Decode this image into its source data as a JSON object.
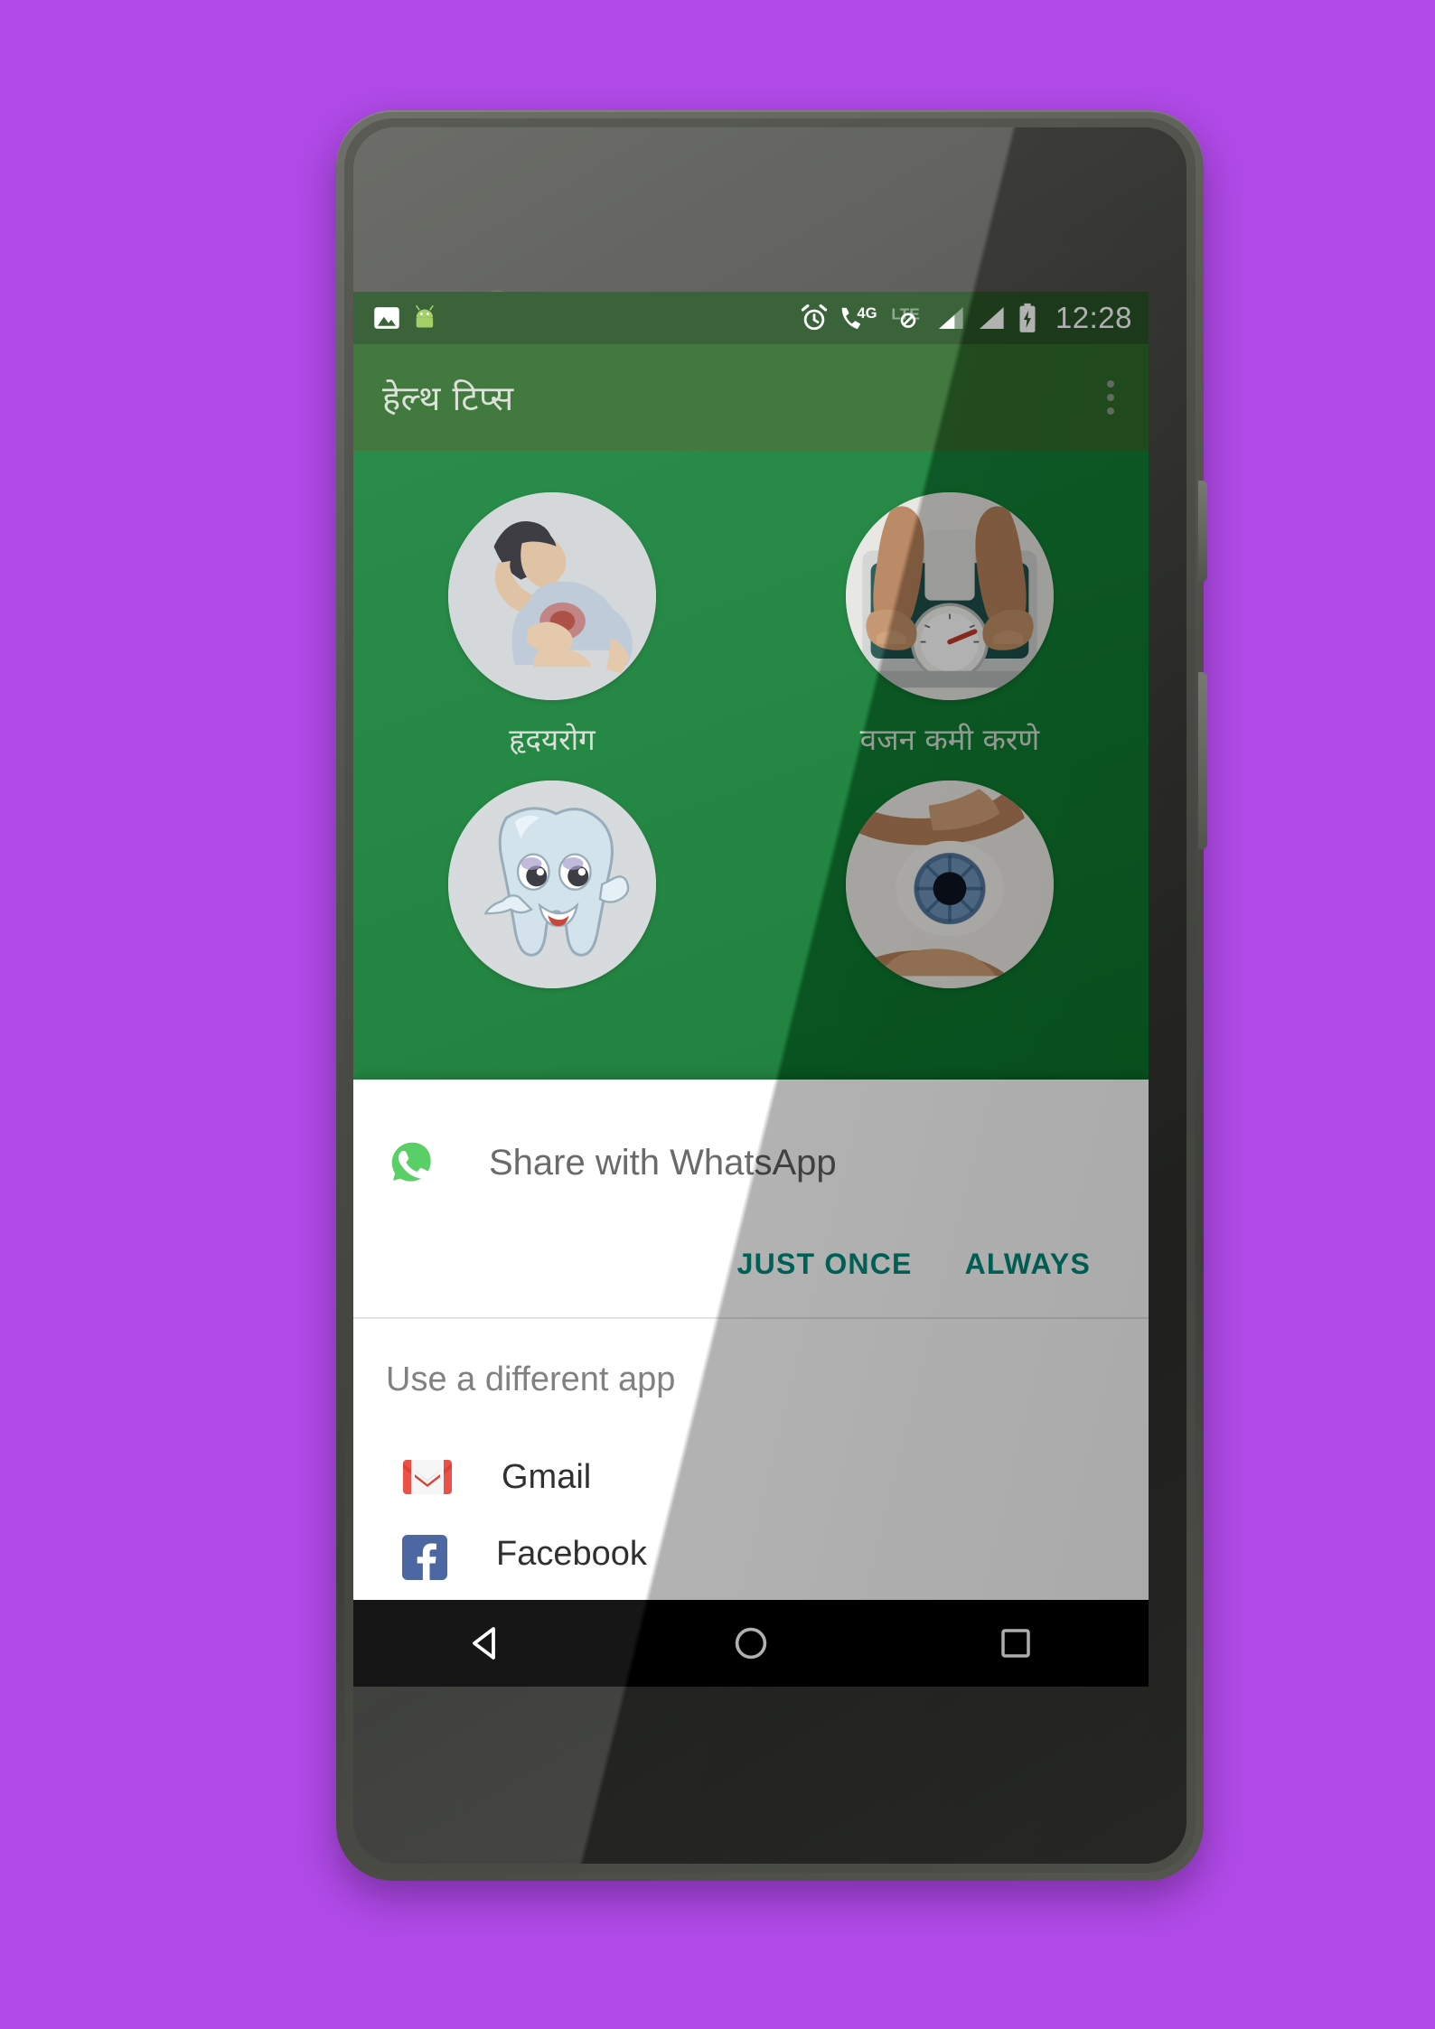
{
  "background": {
    "color": "#b14ae8"
  },
  "device": {
    "name": "android-phone",
    "body_color": "#4e4f49"
  },
  "statusbar": {
    "time": "12:28",
    "left_icons": [
      {
        "name": "photo-icon",
        "label": "Image"
      },
      {
        "name": "android-icon",
        "label": "Android"
      }
    ],
    "right_icons": [
      {
        "name": "alarm-clock-icon",
        "label": "Alarm"
      },
      {
        "name": "phone-4g-icon",
        "label": "4G"
      },
      {
        "name": "lte-disabled-icon",
        "label": "LTE"
      },
      {
        "name": "signal-bars-icon-1",
        "label": "Signal 1"
      },
      {
        "name": "signal-bars-icon-2",
        "label": "Signal 2"
      },
      {
        "name": "battery-charging-icon",
        "label": "Battery charging"
      }
    ],
    "background_color": "#295427"
  },
  "appbar": {
    "title": "हेल्थ टिप्स",
    "background_color": "#2f6c2c",
    "overflow_label": "More options"
  },
  "content": {
    "background_color": "#0a7a2e",
    "tiles": [
      {
        "label": "हृदयरोग",
        "image": "man-chest-pain"
      },
      {
        "label": "वजन कमी करणे",
        "image": "feet-on-weighing-scale"
      },
      {
        "label": "",
        "image": "cartoon-tooth-thumbs-up"
      },
      {
        "label": "",
        "image": "eye-in-hands"
      }
    ]
  },
  "share_dialog": {
    "app_name": "Share with WhatsApp",
    "app_icon": "whatsapp-icon",
    "buttons": [
      {
        "label": "JUST ONCE",
        "name": "just-once-button"
      },
      {
        "label": "ALWAYS",
        "name": "always-button"
      }
    ],
    "accent_color": "#00897b",
    "section_title": "Use a different app",
    "apps": [
      {
        "label": "Gmail",
        "icon": "gmail-icon"
      },
      {
        "label": "Facebook",
        "icon": "facebook-icon"
      }
    ]
  },
  "navbar": {
    "background_color": "#000000",
    "buttons": [
      {
        "name": "back-button",
        "label": "Back"
      },
      {
        "name": "home-button",
        "label": "Home"
      },
      {
        "name": "recents-button",
        "label": "Recents"
      }
    ]
  }
}
